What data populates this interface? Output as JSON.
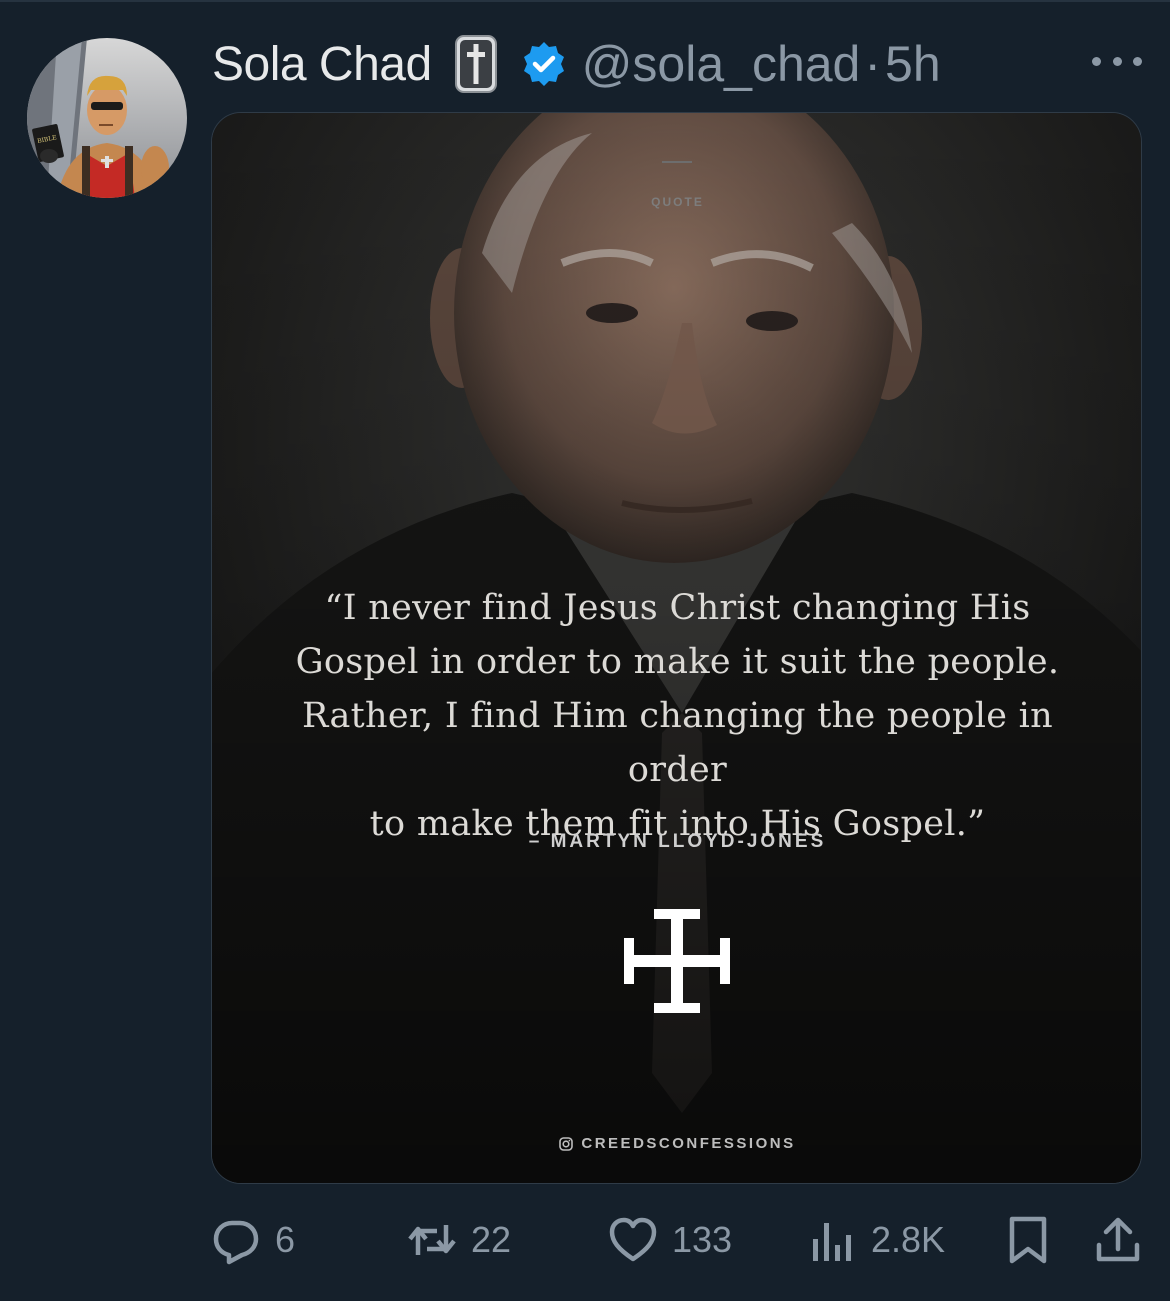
{
  "tweet": {
    "display_name": "Sola Chad",
    "handle": "@sola_chad",
    "separator": "·",
    "time": "5h",
    "name_emoji": "cross-emoji",
    "verified_color": "#1d9bf0",
    "avatar_book_text": "BIBLE"
  },
  "media": {
    "quote_label": "QUOTE",
    "quote_lines": [
      "“I never find Jesus Christ changing His",
      "Gospel in order to make it suit the people.",
      "Rather, I find Him changing the people in order",
      "to make them fit into His Gospel.”"
    ],
    "attribution": "– MARTYN LLOYD-JONES",
    "instagram_handle": "CREEDSCONFESSIONS",
    "logo_icon": "jerusalem-cross-icon"
  },
  "actions": {
    "replies": "6",
    "retweets": "22",
    "likes": "133",
    "views": "2.8K"
  },
  "colors": {
    "background": "#15202b",
    "text_primary": "#e7e9ea",
    "text_secondary": "#8b98a5",
    "accent": "#1d9bf0"
  }
}
